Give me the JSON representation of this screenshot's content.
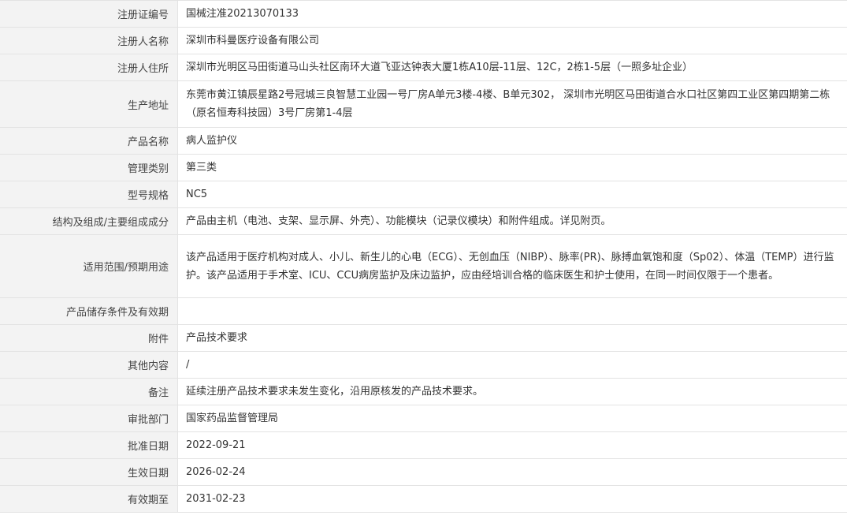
{
  "rows": [
    {
      "label": "注册证编号",
      "value": "国械注准20213070133"
    },
    {
      "label": "注册人名称",
      "value": "深圳市科曼医疗设备有限公司"
    },
    {
      "label": "注册人住所",
      "value": "深圳市光明区马田街道马山头社区南环大道飞亚达钟表大厦1栋A10层-11层、12C，2栋1-5层（一照多址企业）"
    },
    {
      "label": "生产地址",
      "value": "东莞市黄江镇辰星路2号冠城三良智慧工业园一号厂房A单元3楼-4楼、B单元302， 深圳市光明区马田街道合水口社区第四工业区第四期第二栋（原名恒寿科技园）3号厂房第1-4层"
    },
    {
      "label": "产品名称",
      "value": "病人监护仪"
    },
    {
      "label": "管理类别",
      "value": "第三类"
    },
    {
      "label": "型号规格",
      "value": "NC5"
    },
    {
      "label": "结构及组成/主要组成成分",
      "value": "产品由主机（电池、支架、显示屏、外壳）、功能模块（记录仪模块）和附件组成。详见附页。"
    },
    {
      "label": "适用范围/预期用途",
      "value": "该产品适用于医疗机构对成人、小儿、新生儿的心电（ECG）、无创血压（NIBP）、脉率(PR)、脉搏血氧饱和度（Sp02）、体温（TEMP）进行监护。该产品适用于手术室、ICU、CCU病房监护及床边监护，应由经培训合格的临床医生和护士使用，在同一时间仅限于一个患者。"
    },
    {
      "label": "产品储存条件及有效期",
      "value": ""
    },
    {
      "label": "附件",
      "value": "产品技术要求"
    },
    {
      "label": "其他内容",
      "value": "/"
    },
    {
      "label": "备注",
      "value": "延续注册产品技术要求未发生变化，沿用原核发的产品技术要求。"
    },
    {
      "label": "审批部门",
      "value": "国家药品监督管理局"
    },
    {
      "label": "批准日期",
      "value": "2022-09-21"
    },
    {
      "label": "生效日期",
      "value": "2026-02-24"
    },
    {
      "label": "有效期至",
      "value": "2031-02-23"
    }
  ]
}
